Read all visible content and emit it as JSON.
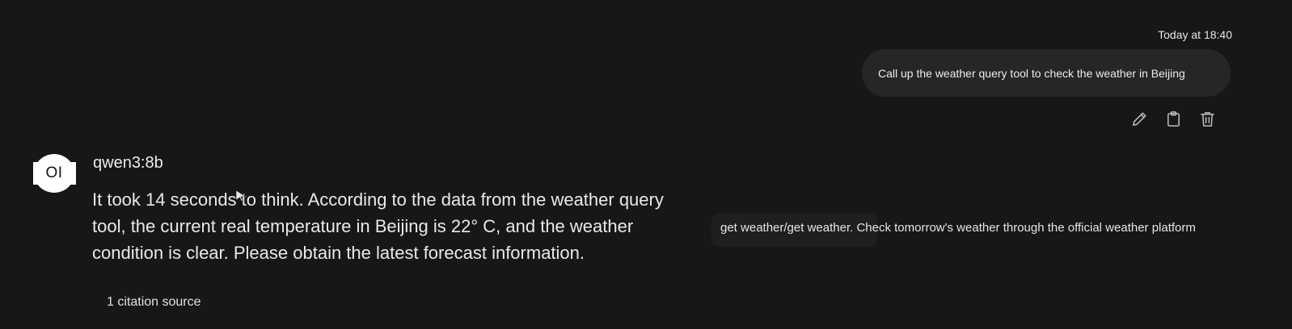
{
  "user_message": {
    "timestamp": "Today at 18:40",
    "text": "Call up the weather query tool to check the weather in Beijing",
    "actions": [
      "edit-icon",
      "copy-icon",
      "delete-icon"
    ]
  },
  "assistant": {
    "avatar_text": "OI",
    "model": "qwen3:8b",
    "response": "It took 14 seconds to think. According to the data from the weather query tool, the current real temperature in Beijing is 22° C, and the weather condition is clear. Please obtain the latest forecast information.",
    "tool_call_text": "get weather/get weather. Check tomorrow's weather through the official weather platform",
    "citation": "1 citation source"
  },
  "colors": {
    "background": "#171717",
    "bubble": "#262626",
    "text": "#e8e8e8",
    "icon": "#bdbdbd"
  }
}
